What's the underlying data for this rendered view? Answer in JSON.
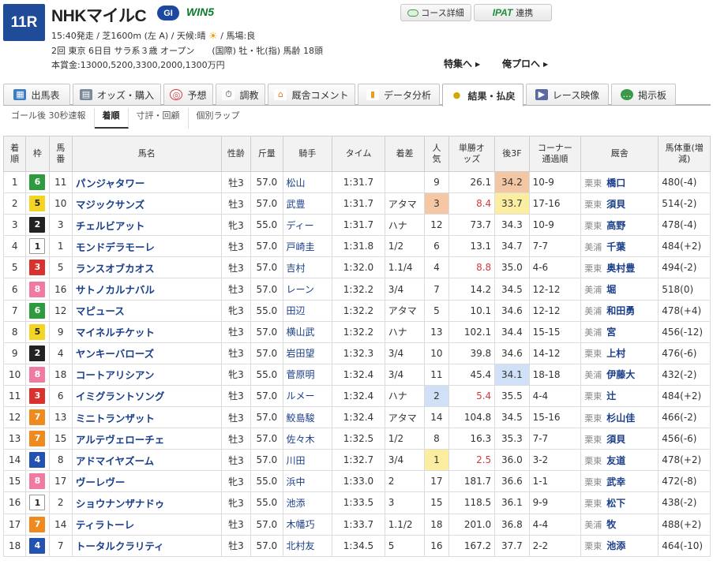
{
  "race": {
    "number": "11R",
    "name": "NHKマイルC",
    "grade": "GI",
    "win5": "WIN5",
    "line1": "15:40発走 / 芝1600m (左 A) / 天候:晴",
    "line1b": "/ 馬場:良",
    "line2": "2回 東京 6日目 サラ系３歳 オープン　　(国際) 牡・牝(指) 馬齢 18頭",
    "line3": "本賞金:13000,5200,3300,2000,1300万円"
  },
  "buttons": {
    "course_detail": "コース詳細",
    "ipat_logo": "IPAT",
    "ipat_link": "連携",
    "special": "特集へ",
    "ore_pro": "俺プロへ"
  },
  "tabs": [
    {
      "label": "出馬表",
      "icon": "table-icon",
      "color": "#3d7dc4"
    },
    {
      "label": "オッズ・購入",
      "icon": "odds-icon",
      "color": "#7a8a9a"
    },
    {
      "label": "予想",
      "icon": "target-icon",
      "color": "#d23c3c"
    },
    {
      "label": "調教",
      "icon": "stopwatch-icon",
      "color": "#444444"
    },
    {
      "label": "厩舎コメント",
      "icon": "stable-icon",
      "color": "#e07a2a"
    },
    {
      "label": "データ分析",
      "icon": "bar-chart-icon",
      "color": "#e0a020"
    },
    {
      "label": "結果・払戻",
      "icon": "coins-icon",
      "color": "#d4a800",
      "active": true
    },
    {
      "label": "レース映像",
      "icon": "video-icon",
      "color": "#5a6aa0"
    },
    {
      "label": "掲示板",
      "icon": "chat-icon",
      "color": "#3a9a4a"
    }
  ],
  "subtabs": [
    {
      "label": "ゴール後 30秒速報"
    },
    {
      "label": "着順",
      "active": true
    },
    {
      "label": "寸評・回顧"
    },
    {
      "label": "個別ラップ"
    }
  ],
  "table": {
    "headers": {
      "rank": "着順",
      "waku": "枠",
      "num": "馬番",
      "horse": "馬名",
      "sex_age": "性齢",
      "weight": "斤量",
      "jockey": "騎手",
      "time": "タイム",
      "margin": "着差",
      "pop": "人気",
      "odds": "単勝オッズ",
      "last3f": "後3F",
      "corner": "コーナー通過順",
      "trainer": "厩舎",
      "body": "馬体重(増減)"
    },
    "rows": [
      {
        "rank": "1",
        "waku": "6",
        "num": "11",
        "horse": "パンジャタワー",
        "sex": "牡3",
        "weight": "57.0",
        "jockey": "松山",
        "time": "1:31.7",
        "margin": "",
        "pop": "9",
        "odds": "26.1",
        "last3f": "34.2",
        "corner": "10-9",
        "region": "栗東",
        "trainer": "橋口",
        "body": "480(-4)"
      },
      {
        "rank": "2",
        "waku": "5",
        "num": "10",
        "horse": "マジックサンズ",
        "sex": "牡3",
        "weight": "57.0",
        "jockey": "武豊",
        "time": "1:31.7",
        "margin": "アタマ",
        "pop": "3",
        "odds": "8.4",
        "last3f": "33.7",
        "corner": "17-16",
        "region": "栗東",
        "trainer": "須貝",
        "body": "514(-2)"
      },
      {
        "rank": "3",
        "waku": "2",
        "num": "3",
        "horse": "チェルビアット",
        "sex": "牝3",
        "weight": "55.0",
        "jockey": "ディー",
        "time": "1:31.7",
        "margin": "ハナ",
        "pop": "12",
        "odds": "73.7",
        "last3f": "34.3",
        "corner": "10-9",
        "region": "栗東",
        "trainer": "高野",
        "body": "478(-4)"
      },
      {
        "rank": "4",
        "waku": "1",
        "num": "1",
        "horse": "モンドデラモーレ",
        "sex": "牡3",
        "weight": "57.0",
        "jockey": "戸崎圭",
        "time": "1:31.8",
        "margin": "1/2",
        "pop": "6",
        "odds": "13.1",
        "last3f": "34.7",
        "corner": "7-7",
        "region": "美浦",
        "trainer": "千葉",
        "body": "484(+2)"
      },
      {
        "rank": "5",
        "waku": "3",
        "num": "5",
        "horse": "ランスオブカオス",
        "sex": "牡3",
        "weight": "57.0",
        "jockey": "吉村",
        "time": "1:32.0",
        "margin": "1.1/4",
        "pop": "4",
        "odds": "8.8",
        "last3f": "35.0",
        "corner": "4-6",
        "region": "栗東",
        "trainer": "奥村豊",
        "body": "494(-2)"
      },
      {
        "rank": "6",
        "waku": "8",
        "num": "16",
        "horse": "サトノカルナバル",
        "sex": "牡3",
        "weight": "57.0",
        "jockey": "レーン",
        "time": "1:32.2",
        "margin": "3/4",
        "pop": "7",
        "odds": "14.2",
        "last3f": "34.5",
        "corner": "12-12",
        "region": "美浦",
        "trainer": "堀",
        "body": "518(0)"
      },
      {
        "rank": "7",
        "waku": "6",
        "num": "12",
        "horse": "マピュース",
        "sex": "牝3",
        "weight": "55.0",
        "jockey": "田辺",
        "time": "1:32.2",
        "margin": "アタマ",
        "pop": "5",
        "odds": "10.1",
        "last3f": "34.6",
        "corner": "12-12",
        "region": "美浦",
        "trainer": "和田勇",
        "body": "478(+4)"
      },
      {
        "rank": "8",
        "waku": "5",
        "num": "9",
        "horse": "マイネルチケット",
        "sex": "牡3",
        "weight": "57.0",
        "jockey": "横山武",
        "time": "1:32.2",
        "margin": "ハナ",
        "pop": "13",
        "odds": "102.1",
        "last3f": "34.4",
        "corner": "15-15",
        "region": "美浦",
        "trainer": "宮",
        "body": "456(-12)"
      },
      {
        "rank": "9",
        "waku": "2",
        "num": "4",
        "horse": "ヤンキーバローズ",
        "sex": "牡3",
        "weight": "57.0",
        "jockey": "岩田望",
        "time": "1:32.3",
        "margin": "3/4",
        "pop": "10",
        "odds": "39.8",
        "last3f": "34.6",
        "corner": "14-12",
        "region": "栗東",
        "trainer": "上村",
        "body": "476(-6)"
      },
      {
        "rank": "10",
        "waku": "8",
        "num": "18",
        "horse": "コートアリシアン",
        "sex": "牝3",
        "weight": "55.0",
        "jockey": "菅原明",
        "time": "1:32.4",
        "margin": "3/4",
        "pop": "11",
        "odds": "45.4",
        "last3f": "34.1",
        "corner": "18-18",
        "region": "美浦",
        "trainer": "伊藤大",
        "body": "432(-2)"
      },
      {
        "rank": "11",
        "waku": "3",
        "num": "6",
        "horse": "イミグラントソング",
        "sex": "牡3",
        "weight": "57.0",
        "jockey": "ルメー",
        "time": "1:32.4",
        "margin": "ハナ",
        "pop": "2",
        "odds": "5.4",
        "last3f": "35.5",
        "corner": "4-4",
        "region": "栗東",
        "trainer": "辻",
        "body": "484(+2)"
      },
      {
        "rank": "12",
        "waku": "7",
        "num": "13",
        "horse": "ミニトランザット",
        "sex": "牡3",
        "weight": "57.0",
        "jockey": "鮫島駿",
        "time": "1:32.4",
        "margin": "アタマ",
        "pop": "14",
        "odds": "104.8",
        "last3f": "34.5",
        "corner": "15-16",
        "region": "栗東",
        "trainer": "杉山佳",
        "body": "466(-2)"
      },
      {
        "rank": "13",
        "waku": "7",
        "num": "15",
        "horse": "アルテヴェローチェ",
        "sex": "牡3",
        "weight": "57.0",
        "jockey": "佐々木",
        "time": "1:32.5",
        "margin": "1/2",
        "pop": "8",
        "odds": "16.3",
        "last3f": "35.3",
        "corner": "7-7",
        "region": "栗東",
        "trainer": "須貝",
        "body": "456(-6)"
      },
      {
        "rank": "14",
        "waku": "4",
        "num": "8",
        "horse": "アドマイヤズーム",
        "sex": "牡3",
        "weight": "57.0",
        "jockey": "川田",
        "time": "1:32.7",
        "margin": "3/4",
        "pop": "1",
        "odds": "2.5",
        "last3f": "36.0",
        "corner": "3-2",
        "region": "栗東",
        "trainer": "友道",
        "body": "478(+2)"
      },
      {
        "rank": "15",
        "waku": "8",
        "num": "17",
        "horse": "ヴーレヴー",
        "sex": "牝3",
        "weight": "55.0",
        "jockey": "浜中",
        "time": "1:33.0",
        "margin": "2",
        "pop": "17",
        "odds": "181.7",
        "last3f": "36.6",
        "corner": "1-1",
        "region": "栗東",
        "trainer": "武幸",
        "body": "472(-8)"
      },
      {
        "rank": "16",
        "waku": "1",
        "num": "2",
        "horse": "ショウナンザナドゥ",
        "sex": "牝3",
        "weight": "55.0",
        "jockey": "池添",
        "time": "1:33.5",
        "margin": "3",
        "pop": "15",
        "odds": "118.5",
        "last3f": "36.1",
        "corner": "9-9",
        "region": "栗東",
        "trainer": "松下",
        "body": "438(-2)"
      },
      {
        "rank": "17",
        "waku": "7",
        "num": "14",
        "horse": "ティラトーレ",
        "sex": "牡3",
        "weight": "57.0",
        "jockey": "木幡巧",
        "time": "1:33.7",
        "margin": "1.1/2",
        "pop": "18",
        "odds": "201.0",
        "last3f": "36.8",
        "corner": "4-4",
        "region": "美浦",
        "trainer": "牧",
        "body": "488(+2)"
      },
      {
        "rank": "18",
        "waku": "4",
        "num": "7",
        "horse": "トータルクラリティ",
        "sex": "牡3",
        "weight": "57.0",
        "jockey": "北村友",
        "time": "1:34.5",
        "margin": "5",
        "pop": "16",
        "odds": "167.2",
        "last3f": "37.7",
        "corner": "2-2",
        "region": "栗東",
        "trainer": "池添",
        "body": "464(-10)"
      }
    ]
  }
}
